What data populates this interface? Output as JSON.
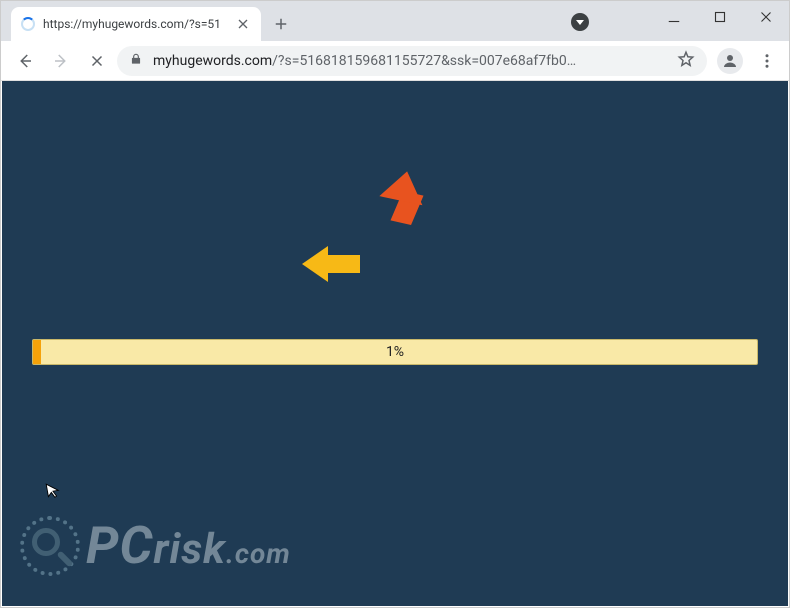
{
  "tab": {
    "title": "https://myhugewords.com/?s=51"
  },
  "url": {
    "host": "myhugewords.com",
    "path": "/?s=516818159681155727&ssk=007e68af7fb0…"
  },
  "progress": {
    "label": "1%"
  },
  "watermark": {
    "brand_pc": "PC",
    "brand_rest": "risk",
    "brand_domain": ".com"
  }
}
